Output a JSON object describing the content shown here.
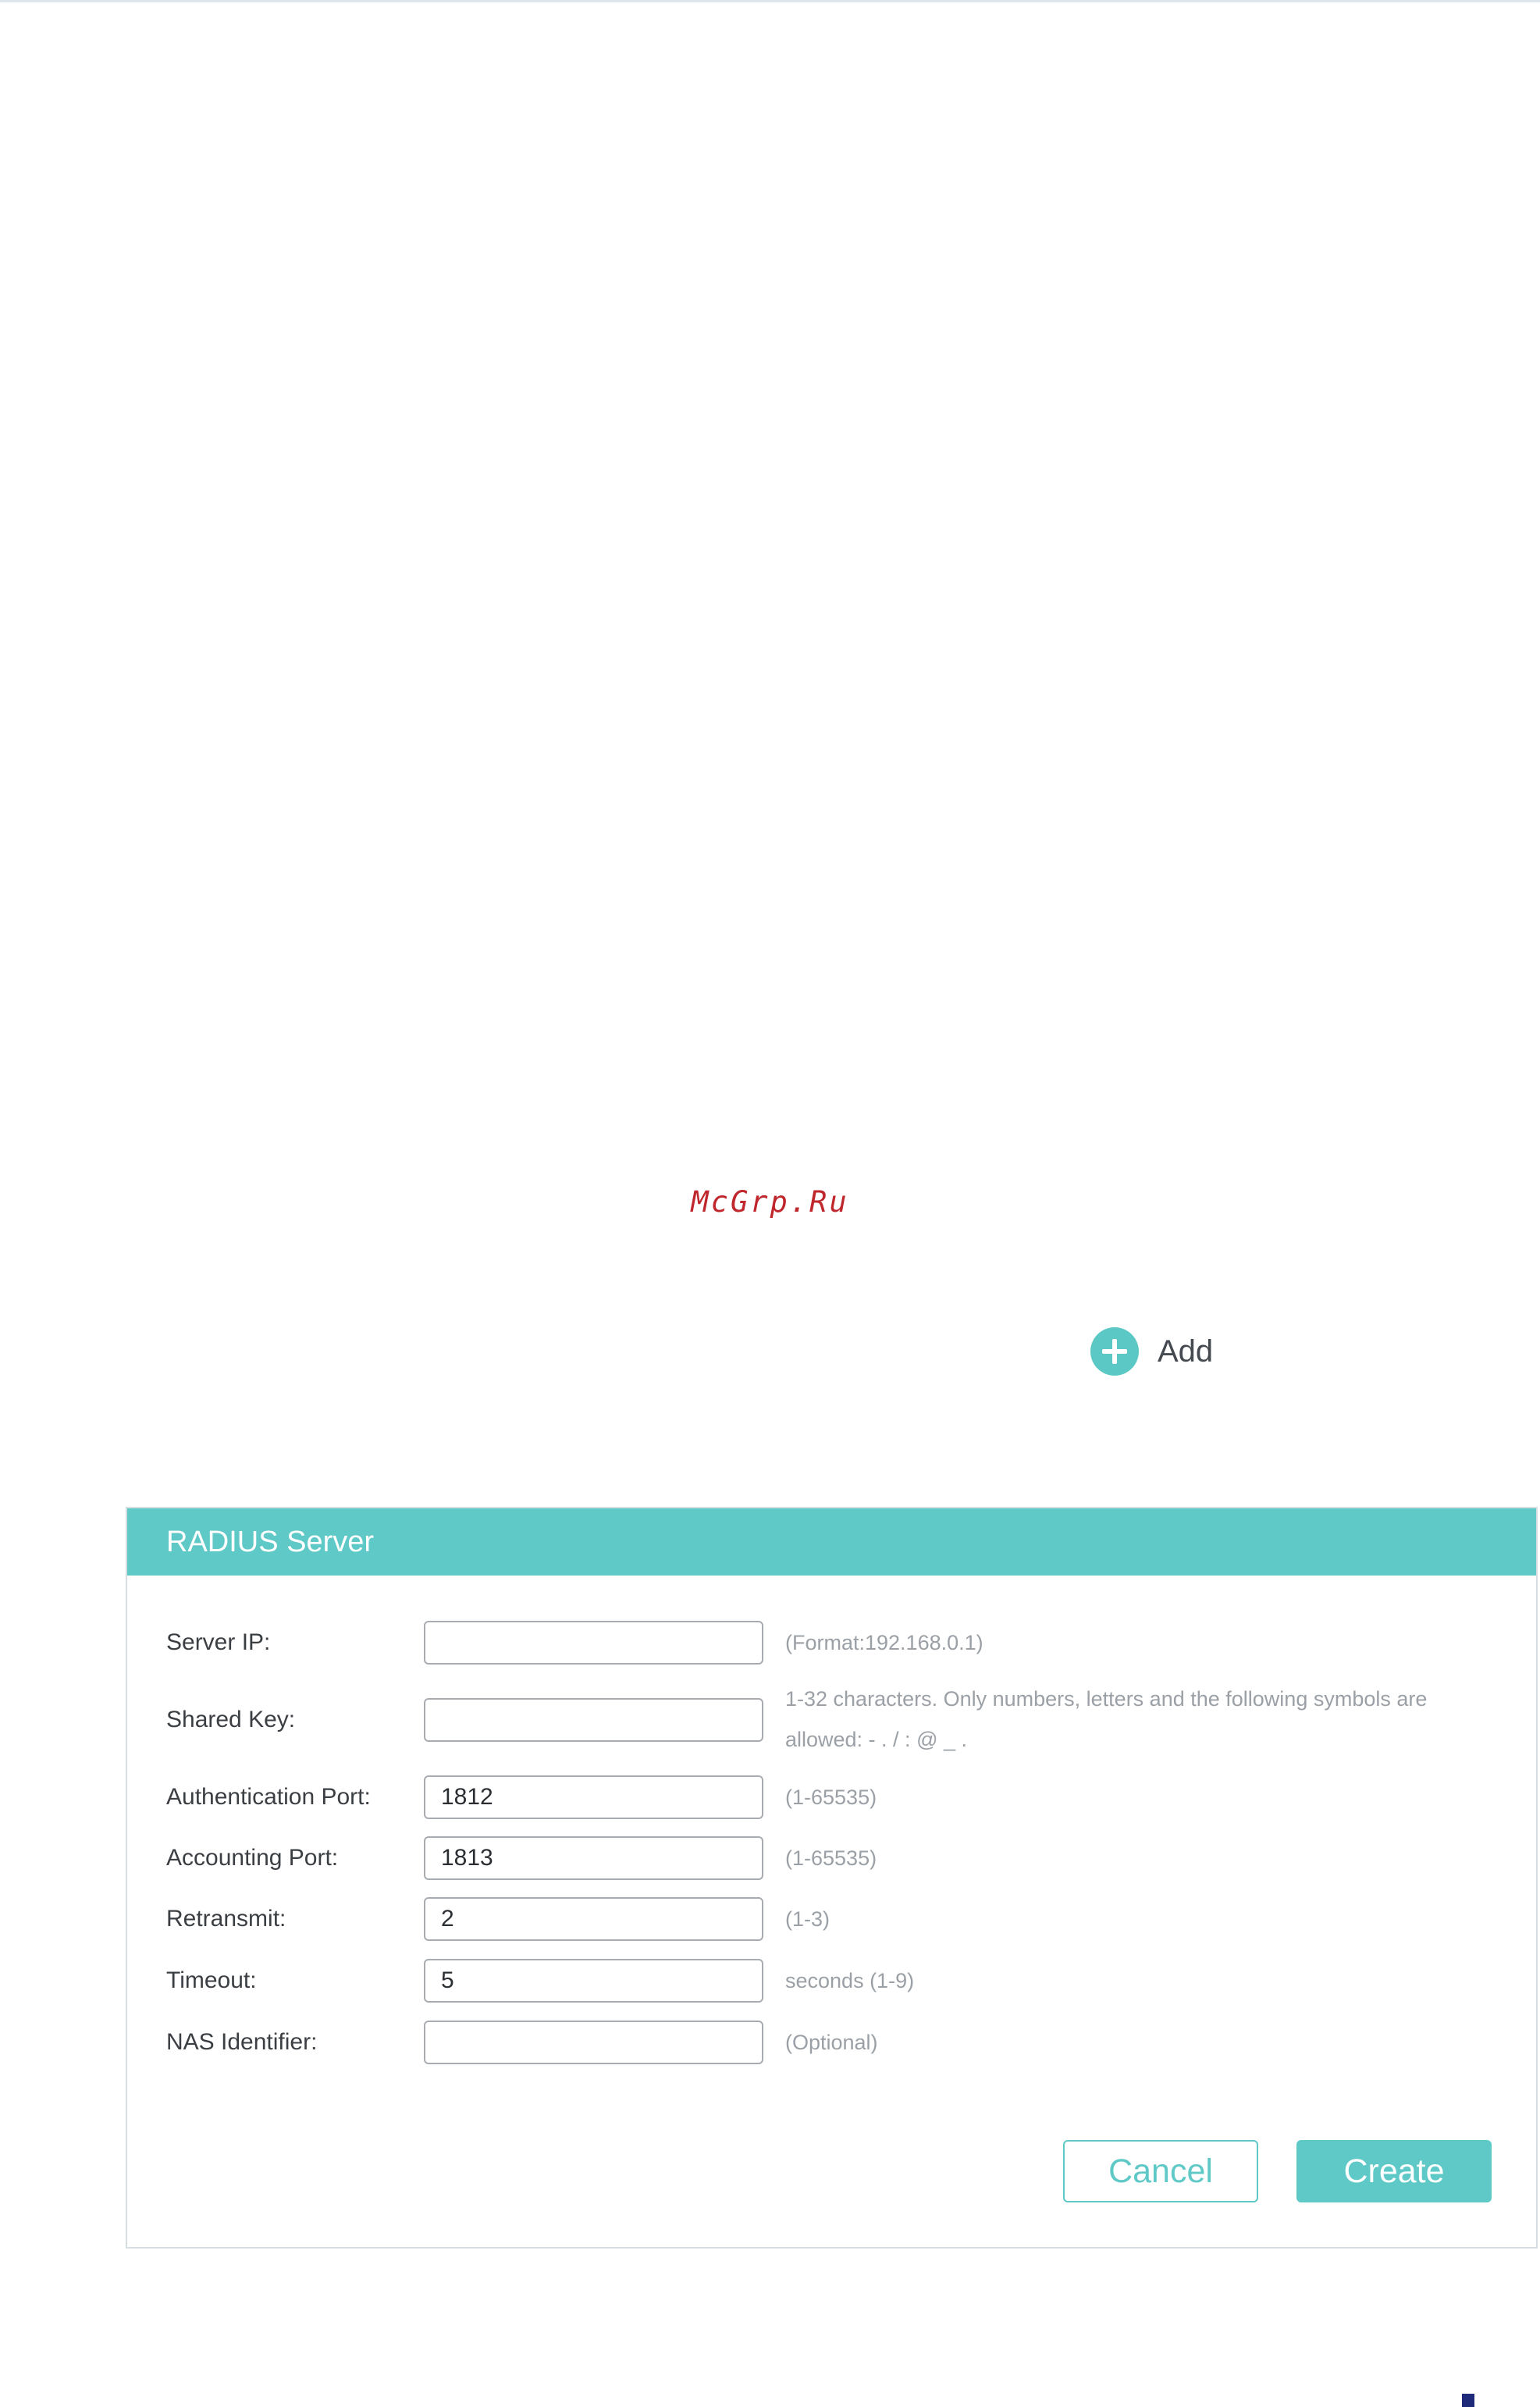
{
  "watermark": "McGrp.Ru",
  "add_button": {
    "label": "Add",
    "icon": "plus-circle-icon",
    "color": "#5cc8c5"
  },
  "panel": {
    "title": "RADIUS Server",
    "accent_color": "#5ec9c6",
    "fields": {
      "server_ip": {
        "label": "Server IP:",
        "value": "",
        "hint": "(Format:192.168.0.1)"
      },
      "shared_key": {
        "label": "Shared Key:",
        "value": "",
        "hint_line1": "1-32 characters. Only numbers, letters and the following symbols are",
        "hint_line2": "allowed: - . / : @ _ ."
      },
      "auth_port": {
        "label": "Authentication Port:",
        "value": "1812",
        "hint": "(1-65535)"
      },
      "acct_port": {
        "label": "Accounting Port:",
        "value": "1813",
        "hint": "(1-65535)"
      },
      "retransmit": {
        "label": "Retransmit:",
        "value": "2",
        "hint": "(1-3)"
      },
      "timeout": {
        "label": "Timeout:",
        "value": "5",
        "hint": "seconds (1-9)"
      },
      "nas_identifier": {
        "label": "NAS Identifier:",
        "value": "",
        "hint": "(Optional)"
      }
    },
    "cancel_label": "Cancel",
    "create_label": "Create"
  }
}
